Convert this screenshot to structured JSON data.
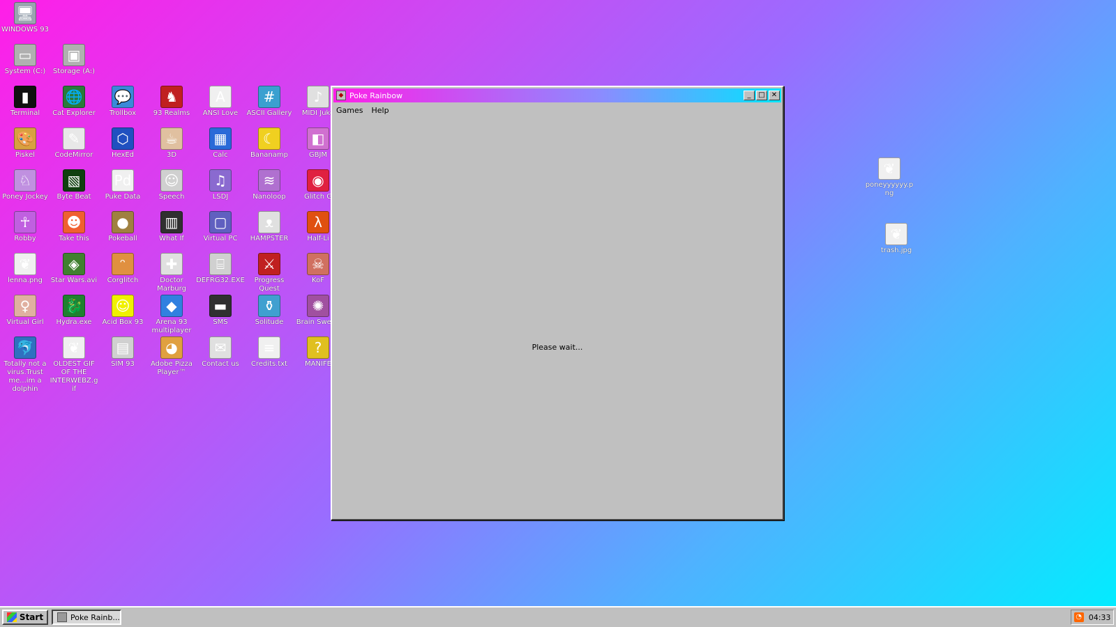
{
  "desktop": {
    "icons": [
      {
        "label": "WINDOWS 93",
        "icon": "computer-icon",
        "color": "#9aa4b0",
        "glyph": "🖥"
      },
      {
        "label": "System (C:)",
        "icon": "drive-icon",
        "color": "#b0b0b0",
        "glyph": "▭"
      },
      {
        "label": "Storage (A:)",
        "icon": "floppy-drive-icon",
        "color": "#b0b0b0",
        "glyph": "▣"
      },
      {
        "label": "Terminal",
        "icon": "terminal-icon",
        "color": "#101010",
        "glyph": "▮"
      },
      {
        "label": "Cat Explorer",
        "icon": "globe-cat-icon",
        "color": "#2a7a3a",
        "glyph": "🌐"
      },
      {
        "label": "Trollbox",
        "icon": "chat-icon",
        "color": "#3a8ad8",
        "glyph": "💬"
      },
      {
        "label": "93 Realms",
        "icon": "knight-icon",
        "color": "#c02020",
        "glyph": "♞"
      },
      {
        "label": "ANSI Love",
        "icon": "ansi-icon",
        "color": "#f0f0f0",
        "glyph": "A"
      },
      {
        "label": "ASCII Gallery",
        "icon": "ascii-icon",
        "color": "#3aa0d0",
        "glyph": "#"
      },
      {
        "label": "MIDI Juke",
        "icon": "piano-icon",
        "color": "#e0e0e0",
        "glyph": "♪"
      },
      {
        "label": "Piskel",
        "icon": "palette-icon",
        "color": "#d8a040",
        "glyph": "🎨"
      },
      {
        "label": "CodeMirror",
        "icon": "codemirror-icon",
        "color": "#e8e8e8",
        "glyph": "✎"
      },
      {
        "label": "HexEd",
        "icon": "cube-icon",
        "color": "#2050c0",
        "glyph": "⬡"
      },
      {
        "label": "3D",
        "icon": "teapot-icon",
        "color": "#e0c0a0",
        "glyph": "☕"
      },
      {
        "label": "Calc",
        "icon": "calculator-icon",
        "color": "#2a6ad8",
        "glyph": "▦"
      },
      {
        "label": "Bananamp",
        "icon": "banana-icon",
        "color": "#f0d020",
        "glyph": "☾"
      },
      {
        "label": "GBJM",
        "icon": "gb-icon",
        "color": "#d070d0",
        "glyph": "◧"
      },
      {
        "label": "Poney Jockey",
        "icon": "pony-icon",
        "color": "#c090e0",
        "glyph": "♘"
      },
      {
        "label": "Byte Beat",
        "icon": "bytebeat-icon",
        "color": "#104010",
        "glyph": "▧"
      },
      {
        "label": "Puke Data",
        "icon": "pd-icon",
        "color": "#f0f0f0",
        "glyph": "Pd"
      },
      {
        "label": "Speech",
        "icon": "face-icon",
        "color": "#d0d0d0",
        "glyph": "☺"
      },
      {
        "label": "LSDJ",
        "icon": "lsdj-icon",
        "color": "#8a6ad0",
        "glyph": "♫"
      },
      {
        "label": "Nanoloop",
        "icon": "nanoloop-icon",
        "color": "#b070d0",
        "glyph": "≋"
      },
      {
        "label": "Glitch G",
        "icon": "lips-icon",
        "color": "#e02040",
        "glyph": "◉"
      },
      {
        "label": "Robby",
        "icon": "stickman-icon",
        "color": "#c060e0",
        "glyph": "☥"
      },
      {
        "label": "Take this",
        "icon": "clown-icon",
        "color": "#f06030",
        "glyph": "☻"
      },
      {
        "label": "Pokeball",
        "icon": "ball-icon",
        "color": "#a08040",
        "glyph": "●"
      },
      {
        "label": "What If",
        "icon": "chart-icon",
        "color": "#303030",
        "glyph": "▥"
      },
      {
        "label": "Virtual PC",
        "icon": "virtual-pc-icon",
        "color": "#6060c0",
        "glyph": "▢"
      },
      {
        "label": "HAMPSTER",
        "icon": "hamster-icon",
        "color": "#e0e0e0",
        "glyph": "ᴥ"
      },
      {
        "label": "Half-Li",
        "icon": "lambda-icon",
        "color": "#e05010",
        "glyph": "λ"
      },
      {
        "label": "lenna.png",
        "icon": "image-file-icon",
        "color": "#f0f0f0",
        "glyph": "❦"
      },
      {
        "label": "Star Wars.avi",
        "icon": "yoda-icon",
        "color": "#408030",
        "glyph": "◈"
      },
      {
        "label": "Corglitch",
        "icon": "corgi-icon",
        "color": "#e09040",
        "glyph": "ᵔ"
      },
      {
        "label": "Doctor Marburg",
        "icon": "doctor-icon",
        "color": "#e0e0e0",
        "glyph": "✚"
      },
      {
        "label": "DEFRG32.EXE",
        "icon": "defrag-icon",
        "color": "#d0d0d0",
        "glyph": "⌸"
      },
      {
        "label": "Progress Quest",
        "icon": "sword-icon",
        "color": "#c02020",
        "glyph": "⚔"
      },
      {
        "label": "KoF",
        "icon": "kof-icon",
        "color": "#d07060",
        "glyph": "☠"
      },
      {
        "label": "Virtual Girl",
        "icon": "girl-icon",
        "color": "#e0b0a0",
        "glyph": "♀"
      },
      {
        "label": "Hydra.exe",
        "icon": "hydra-icon",
        "color": "#208030",
        "glyph": "🐉"
      },
      {
        "label": "Acid Box 93",
        "icon": "smiley-icon",
        "color": "#f0f000",
        "glyph": "☺"
      },
      {
        "label": "Arena 93 multiplayer",
        "icon": "arena-cube-icon",
        "color": "#3080e0",
        "glyph": "◆"
      },
      {
        "label": "SMS",
        "icon": "console-icon",
        "color": "#303030",
        "glyph": "▬"
      },
      {
        "label": "Solitude",
        "icon": "bottle-icon",
        "color": "#40a0d0",
        "glyph": "⚱"
      },
      {
        "label": "Brain Sweep",
        "icon": "brain-icon",
        "color": "#a050a0",
        "glyph": "✺"
      },
      {
        "label": "Totally not a virus.Trust me...im a dolphin",
        "icon": "dolphin-icon",
        "color": "#3070c0",
        "glyph": "🐬"
      },
      {
        "label": "OLDEST GIF OF THE INTERWEBZ.gif",
        "icon": "gif-file-icon",
        "color": "#f0f0f0",
        "glyph": "❦"
      },
      {
        "label": "SIM 93",
        "icon": "sim-icon",
        "color": "#d0d0d0",
        "glyph": "▤"
      },
      {
        "label": "Adobe Pizza Player™",
        "icon": "pizza-icon",
        "color": "#e0a040",
        "glyph": "◕"
      },
      {
        "label": "Contact us",
        "icon": "contact-icon",
        "color": "#e0e0e0",
        "glyph": "✉"
      },
      {
        "label": "Credits.txt",
        "icon": "text-file-icon",
        "color": "#f0f0f0",
        "glyph": "≡"
      },
      {
        "label": "MANIFE",
        "icon": "question-icon",
        "color": "#e0c020",
        "glyph": "?"
      },
      {
        "label": "poneyyyyyy.png",
        "icon": "image-file-icon",
        "color": "#f0f0f0",
        "glyph": "❦"
      },
      {
        "label": "trash.jpg",
        "icon": "image-file-icon",
        "color": "#f0f0f0",
        "glyph": "❦"
      }
    ]
  },
  "window": {
    "title": "Poke Rainbow",
    "menu": [
      "Games",
      "Help"
    ],
    "status": "Please wait...",
    "buttons": {
      "minimize": "_",
      "maximize": "□",
      "close": "✕"
    }
  },
  "taskbar": {
    "start_label": "Start",
    "items": [
      "Poke Rainb..."
    ],
    "clock": "04:33",
    "tray_icon": "rss-icon"
  }
}
